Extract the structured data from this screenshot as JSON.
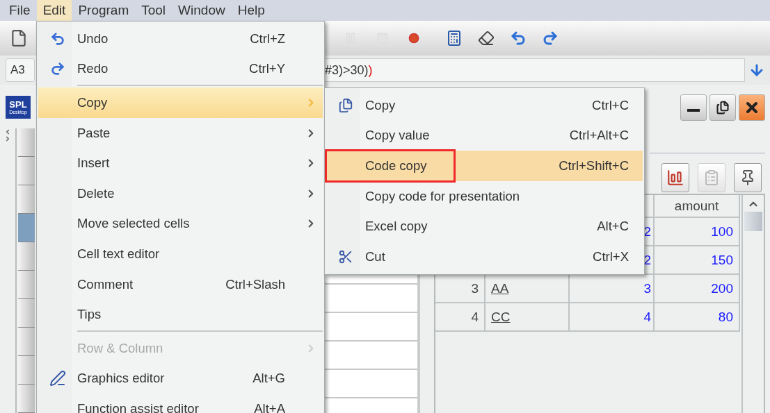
{
  "menu_bar": [
    {
      "label": "File",
      "selected": false
    },
    {
      "label": "Edit",
      "selected": true
    },
    {
      "label": "Program",
      "selected": false
    },
    {
      "label": "Tool",
      "selected": false
    },
    {
      "label": "Window",
      "selected": false
    },
    {
      "label": "Help",
      "selected": false
    }
  ],
  "formula_bar": {
    "cell": "A3",
    "formula": "#3)>30)",
    "unmatched": ")"
  },
  "logo": {
    "title": "SPL",
    "subtitle": "Desktop"
  },
  "row_headers": [
    {
      "selected": false
    },
    {
      "selected": false
    },
    {
      "selected": false
    },
    {
      "selected": true
    },
    {
      "selected": false
    },
    {
      "selected": false
    },
    {
      "selected": false
    },
    {
      "selected": false
    },
    {
      "selected": false
    },
    {
      "selected": false
    }
  ],
  "edit_menu": [
    {
      "kind": "item",
      "label": "Undo",
      "shortcut": "Ctrl+Z",
      "submenu": false,
      "disabled": false,
      "selected": false
    },
    {
      "kind": "item",
      "label": "Redo",
      "shortcut": "Ctrl+Y",
      "submenu": false,
      "disabled": false,
      "selected": false
    },
    {
      "kind": "separator"
    },
    {
      "kind": "item",
      "label": "Copy",
      "submenu": true,
      "disabled": false,
      "selected": true
    },
    {
      "kind": "item",
      "label": "Paste",
      "submenu": true,
      "disabled": false,
      "selected": false
    },
    {
      "kind": "item",
      "label": "Insert",
      "submenu": true,
      "disabled": false,
      "selected": false
    },
    {
      "kind": "item",
      "label": "Delete",
      "submenu": true,
      "disabled": false,
      "selected": false
    },
    {
      "kind": "item",
      "label": "Move selected cells",
      "submenu": true,
      "disabled": false,
      "selected": false
    },
    {
      "kind": "item",
      "label": "Cell text editor",
      "submenu": false,
      "disabled": false,
      "selected": false
    },
    {
      "kind": "item",
      "label": "Comment",
      "shortcut": "Ctrl+Slash",
      "submenu": false,
      "disabled": false,
      "selected": false
    },
    {
      "kind": "item",
      "label": "Tips",
      "submenu": false,
      "disabled": false,
      "selected": false
    },
    {
      "kind": "separator"
    },
    {
      "kind": "item",
      "label": "Row & Column",
      "submenu": true,
      "disabled": true,
      "selected": false
    },
    {
      "kind": "item",
      "label": "Graphics editor",
      "shortcut": "Alt+G",
      "submenu": false,
      "disabled": false,
      "selected": false
    },
    {
      "kind": "item",
      "label": "Function assist editor",
      "shortcut": "Alt+A",
      "submenu": false,
      "disabled": false,
      "selected": false
    }
  ],
  "copy_submenu": [
    {
      "label": "Copy",
      "shortcut": "Ctrl+C",
      "selected": false,
      "outlined": false
    },
    {
      "label": "Copy value",
      "shortcut": "Ctrl+Alt+C",
      "selected": false,
      "outlined": false
    },
    {
      "label": "Code copy",
      "shortcut": "Ctrl+Shift+C",
      "selected": true,
      "outlined": true
    },
    {
      "label": "Copy code for presentation",
      "selected": false,
      "outlined": false
    },
    {
      "label": "Excel copy",
      "shortcut": "Alt+C",
      "selected": false,
      "outlined": false
    },
    {
      "label": "Cut",
      "shortcut": "Ctrl+X",
      "selected": false,
      "outlined": false
    }
  ],
  "table": {
    "columns": [
      {
        "label": "amount"
      }
    ],
    "rows": [
      {
        "column_3": "2",
        "amount": "100"
      },
      {
        "column_3": "2",
        "amount": "150"
      },
      {
        "index": "3",
        "name": "AA",
        "column_3": "3",
        "amount": "200"
      },
      {
        "index": "4",
        "name": "CC",
        "column_3": "4",
        "amount": "80"
      }
    ]
  }
}
